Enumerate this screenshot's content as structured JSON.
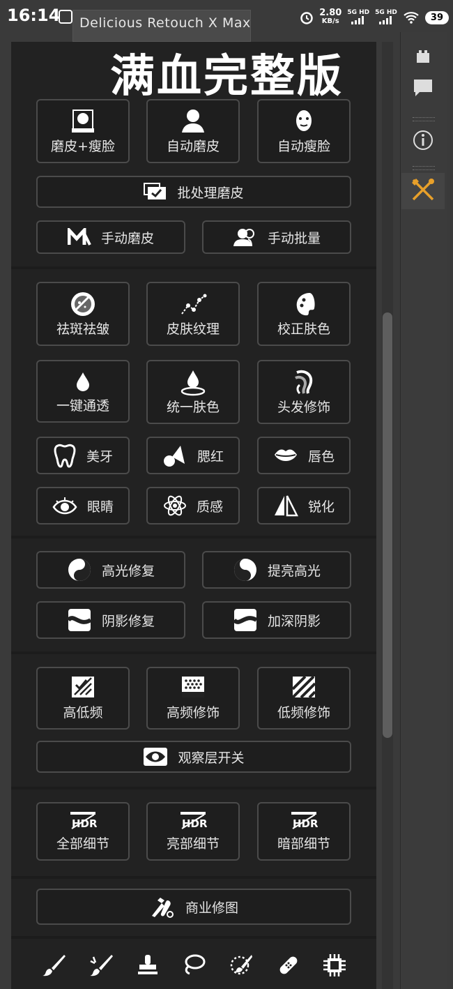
{
  "status_bar": {
    "time": "16:14",
    "speed_value": "2.80",
    "speed_unit": "KB/s",
    "net1": "5G HD",
    "net2": "5G HD",
    "battery": "39"
  },
  "panel": {
    "tab_title": "Delicious Retouch X Max",
    "headline": "满血完整版"
  },
  "buttons": {
    "skin_slim": "磨皮+瘦脸",
    "auto_skin": "自动磨皮",
    "auto_slim": "自动瘦脸",
    "batch_skin": "批处理磨皮",
    "manual_skin": "手动磨皮",
    "manual_batch": "手动批量",
    "remove_spots": "祛斑祛皱",
    "skin_texture": "皮肤纹理",
    "correct_skin": "校正肤色",
    "one_click_clear": "一键通透",
    "unify_skin": "统一肤色",
    "hair_retouch": "头发修饰",
    "whiten_teeth": "美牙",
    "blush": "腮红",
    "lip_color": "唇色",
    "eyes": "眼睛",
    "texture": "质感",
    "sharpen": "锐化",
    "highlight_repair": "高光修复",
    "brighten_highlight": "提亮高光",
    "shadow_repair": "阴影修复",
    "deepen_shadow": "加深阴影",
    "freq_sep": "高低频",
    "high_freq": "高频修饰",
    "low_freq": "低频修饰",
    "observe_layer": "观察层开关",
    "all_detail": "全部细节",
    "bright_detail": "亮部细节",
    "dark_detail": "暗部细节",
    "commercial": "商业修图"
  },
  "icons": {
    "dock": [
      "layers-icon",
      "comment-icon",
      "info-icon",
      "tools-icon"
    ],
    "toolbar": [
      "brush-icon",
      "mixer-brush-icon",
      "stamp-icon",
      "lasso-icon",
      "quick-select-icon",
      "healing-icon",
      "chip-icon"
    ]
  },
  "colors": {
    "accent": "#e8a02a",
    "panel_bg": "#222222",
    "button_bg": "#1e1e1e",
    "button_border": "#4b4b4b"
  }
}
